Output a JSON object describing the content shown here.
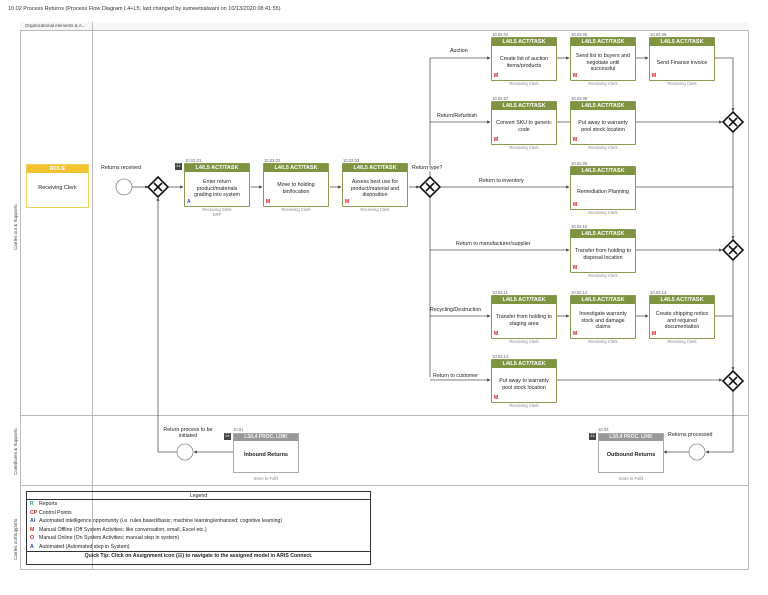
{
  "title": "10.02 Process Returns (Process Flow Diagram L4+L5; last changed by sumeetsalwani on 10/13/2020 08:41:55)",
  "column_header": "Organizational elements & A...",
  "lanes": [
    "Carries out & Supports",
    "Contributes & Supports",
    "Carries out/Supports"
  ],
  "role": {
    "header": "ROLE",
    "name": "Receiving Clerk"
  },
  "task_header": "L4/L5 ACT/TASK",
  "tasks": [
    {
      "id": "10.02.01",
      "name": "Enter return product/materials grading into system",
      "marker": "A",
      "role": "Receiving Clerk",
      "system": "ERP"
    },
    {
      "id": "10.02.02",
      "name": "Move to holding bin/location",
      "marker": "M",
      "role": "Receiving Clerk"
    },
    {
      "id": "10.02.03",
      "name": "Assess best use for product/material and disposition",
      "marker": "M",
      "role": "Receiving Clerk"
    },
    {
      "id": "10.02.04",
      "name": "Create list of auction items/products",
      "marker": "M",
      "role": "Receiving Clerk"
    },
    {
      "id": "10.02.05",
      "name": "Send list to buyers and negotiate until successful",
      "marker": "M",
      "role": "Receiving Clerk"
    },
    {
      "id": "10.02.06",
      "name": "Send Finance invoice",
      "marker": "M",
      "role": "Receiving Clerk"
    },
    {
      "id": "10.02.07",
      "name": "Convert SKU to generic code",
      "marker": "M",
      "role": "Receiving Clerk"
    },
    {
      "id": "10.02.08",
      "name": "Put away to warranty pool stock location",
      "marker": "M",
      "role": "Receiving Clerk"
    },
    {
      "id": "10.02.09",
      "name": "Remediation Planning",
      "marker": "M",
      "role": "Receiving Clerk"
    },
    {
      "id": "10.02.10",
      "name": "Transfer from holding to disposal location",
      "marker": "M",
      "role": "Receiving Clerk"
    },
    {
      "id": "10.02.11",
      "name": "Transfer from holding to staging area",
      "marker": "M",
      "role": "Receiving Clerk"
    },
    {
      "id": "10.02.12",
      "name": "Investigate warranty stock and damage claims",
      "marker": "M",
      "role": "Receiving Clerk"
    },
    {
      "id": "10.02.13",
      "name": "Create shipping notice and required documentation",
      "marker": "M",
      "role": "Receiving Clerk"
    },
    {
      "id": "10.02.14",
      "name": "Put away to warranty pool stock location",
      "marker": "M",
      "role": "Receiving Clerk"
    }
  ],
  "labels": {
    "returns_received": "Returns received",
    "return_type": "Return type?",
    "auction": "Auction",
    "refurbish": "Return/Refurbish",
    "inventory": "Return to inventory",
    "manufacturer": "Return to manufacturer/supplier",
    "recycling": "Recycling/Destruction",
    "customer": "Return to customer",
    "process_initiated": "Return process to be initiated",
    "returns_processed": "Returns processed"
  },
  "links": [
    {
      "id": "10.01",
      "header": "L3/L4 PROC. LINK",
      "name": "Inbound Returns",
      "sub": "Store to Fulfil"
    },
    {
      "id": "10.03",
      "header": "L3/L4 PROC. LINK",
      "name": "Outbound Returns",
      "sub": "Store to Fulfil"
    }
  ],
  "legend": {
    "title": "Legend",
    "items": [
      {
        "icon": "R",
        "text": "Reports",
        "color": "#2a9d4a"
      },
      {
        "icon": "CP",
        "text": "Control Points",
        "color": "#d02020"
      },
      {
        "icon": "AI",
        "text": "Automated intelligence opportunity (i.e. rules based/basic; machine learning/enhanced; cognitive learning)",
        "color": "#3050a0"
      },
      {
        "icon": "M",
        "text": "Manual Offline (Off System Activities; like conversation, email, Excel etc.)",
        "color": "#d02020"
      },
      {
        "icon": "O",
        "text": "Manual Online (On System Activities; manual step in system)",
        "color": "#d02020"
      },
      {
        "icon": "A",
        "text": "Automated (Automated step in System)",
        "color": "#2040c0"
      }
    ],
    "tip": "Quick Tip: Click on Assignment icon (☷) to navigate to the assigned model in ARIS Connect."
  },
  "colors": {
    "task": "#7f9440",
    "role": "#f4c430",
    "manual": "#e01010",
    "auto": "#2040d0"
  }
}
